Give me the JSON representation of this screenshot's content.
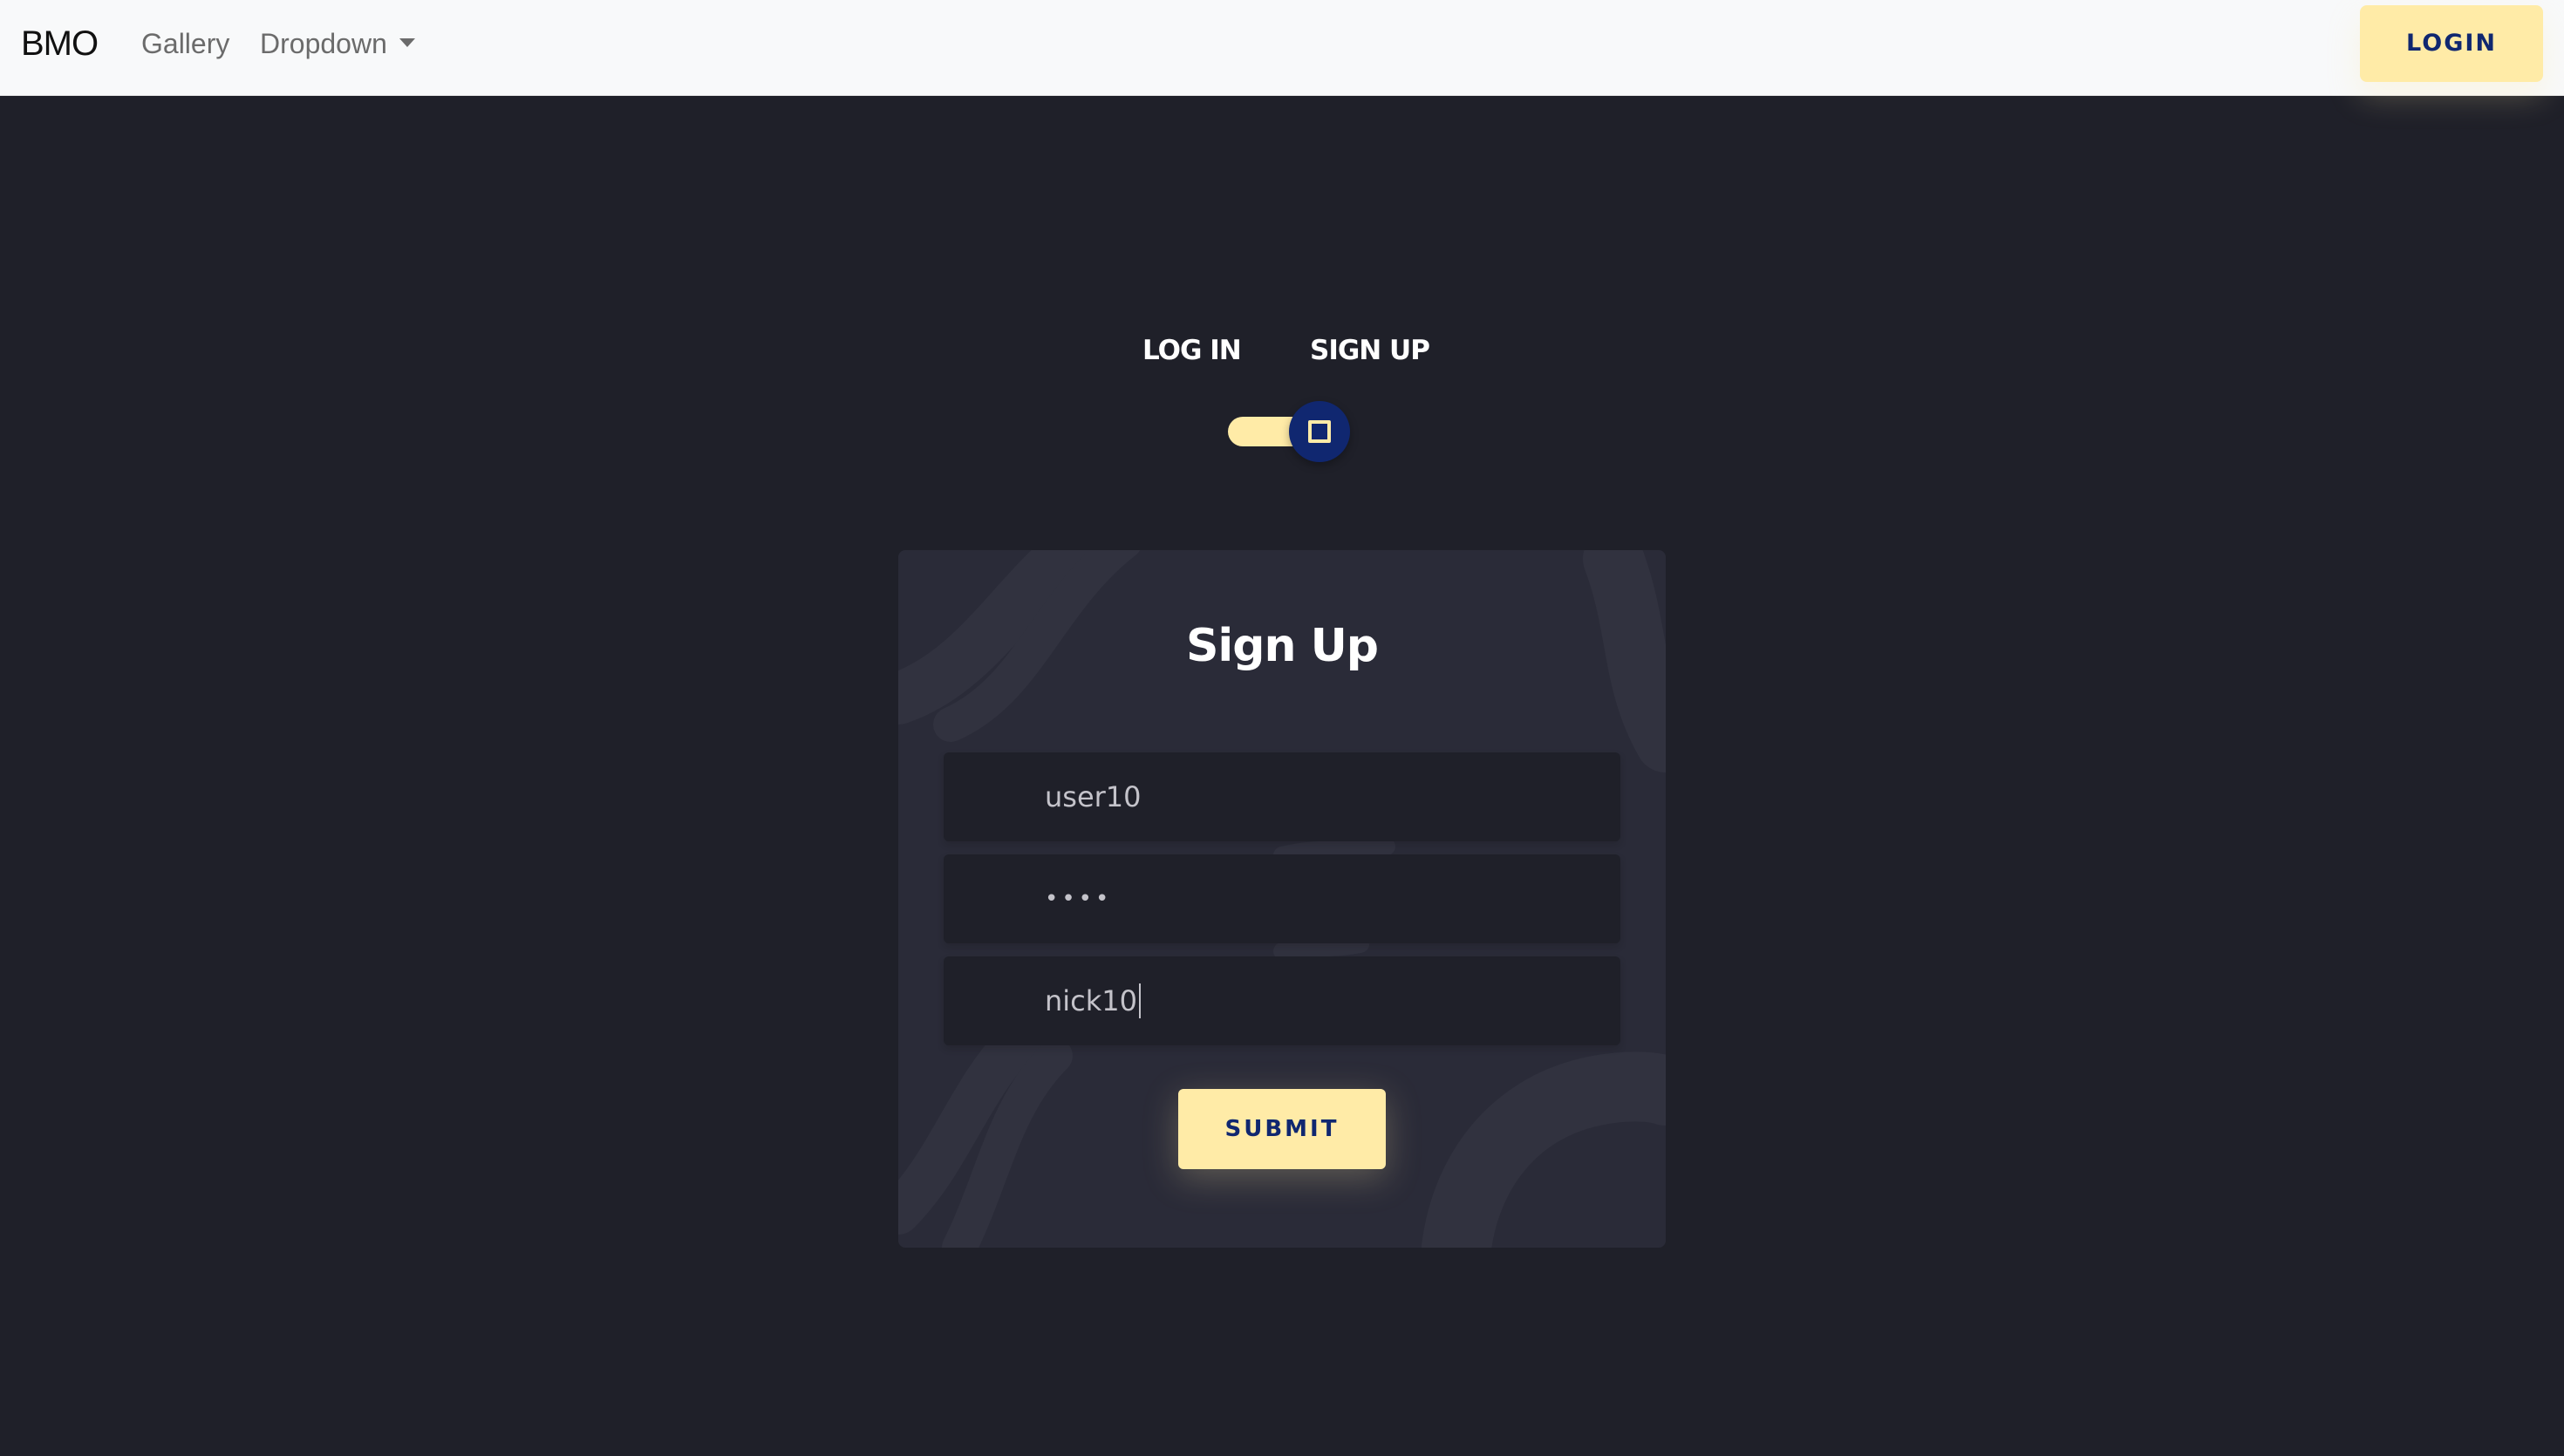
{
  "navbar": {
    "brand": "BMO",
    "links": [
      {
        "label": "Gallery"
      },
      {
        "label": "Dropdown"
      }
    ],
    "login_label": "LOGIN"
  },
  "switch": {
    "login_label": "LOG IN",
    "signup_label": "SIGN UP",
    "checked": true
  },
  "form": {
    "title": "Sign Up",
    "username_value": "user10",
    "password_value": "••••",
    "nickname_value": "nick10",
    "submit_label": "SUBMIT"
  },
  "colors": {
    "page_bg": "#1f2029",
    "card_bg": "#2a2b38",
    "accent": "#ffeba7",
    "accent_text": "#102770",
    "input_text": "#c4c3ca"
  }
}
